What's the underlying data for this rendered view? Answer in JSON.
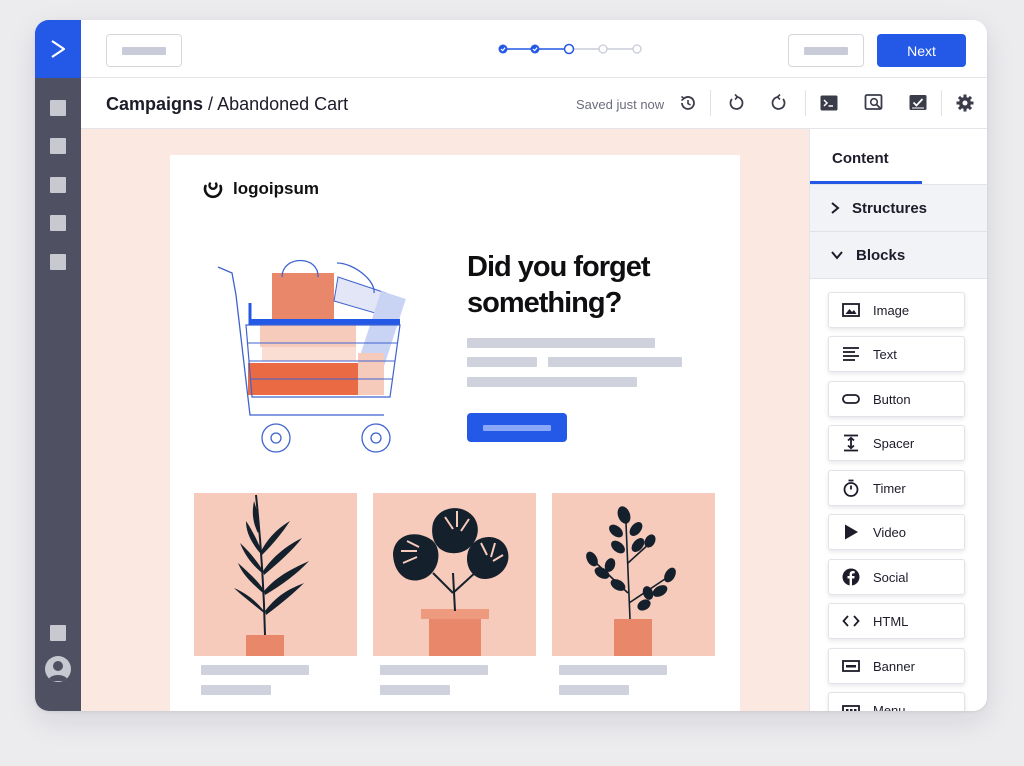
{
  "header": {
    "next_label": "Next",
    "steps_total": 5,
    "steps_completed": 2,
    "current_step": 3
  },
  "breadcrumb": {
    "section": "Campaigns",
    "separator": "/",
    "page": "Abandoned Cart"
  },
  "toolbar": {
    "save_status": "Saved just now",
    "icons": [
      "history-icon",
      "undo-icon",
      "redo-icon",
      "code-icon",
      "preview-icon",
      "checklist-icon",
      "settings-icon"
    ]
  },
  "email": {
    "brand_name": "logoipsum",
    "headline": "Did you forget something?"
  },
  "panel": {
    "tab_label": "Content",
    "sections": {
      "structures": "Structures",
      "blocks": "Blocks"
    },
    "blocks": [
      {
        "label": "Image",
        "icon": "image-icon"
      },
      {
        "label": "Text",
        "icon": "text-icon"
      },
      {
        "label": "Button",
        "icon": "button-icon"
      },
      {
        "label": "Spacer",
        "icon": "spacer-icon"
      },
      {
        "label": "Timer",
        "icon": "timer-icon"
      },
      {
        "label": "Video",
        "icon": "video-icon"
      },
      {
        "label": "Social",
        "icon": "facebook-icon"
      },
      {
        "label": "HTML",
        "icon": "code-brackets-icon"
      },
      {
        "label": "Banner",
        "icon": "banner-icon"
      },
      {
        "label": "Menu",
        "icon": "menu-icon"
      }
    ]
  },
  "colors": {
    "accent": "#2458e6",
    "rail": "#4f5163",
    "canvas_bg": "#fbe8e1",
    "product_bg": "#f7cbbc",
    "terracotta": "#e8876a",
    "plant": "#14202c"
  }
}
